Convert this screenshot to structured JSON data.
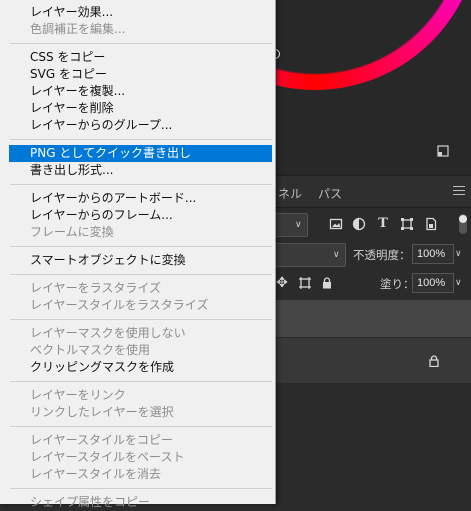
{
  "menu": {
    "items": [
      {
        "label": "レイヤー効果...",
        "enabled": true
      },
      {
        "label": "色調補正を編集...",
        "enabled": false
      },
      {
        "label": "CSS をコピー",
        "enabled": true
      },
      {
        "label": "SVG をコピー",
        "enabled": true
      },
      {
        "label": "レイヤーを複製...",
        "enabled": true
      },
      {
        "label": "レイヤーを削除",
        "enabled": true
      },
      {
        "label": "レイヤーからのグループ...",
        "enabled": true
      },
      {
        "label": "PNG としてクイック書き出し",
        "enabled": true,
        "highlighted": true
      },
      {
        "label": "書き出し形式...",
        "enabled": true
      },
      {
        "label": "レイヤーからのアートボード...",
        "enabled": true
      },
      {
        "label": "レイヤーからのフレーム...",
        "enabled": true
      },
      {
        "label": "フレームに変換",
        "enabled": false
      },
      {
        "label": "スマートオブジェクトに変換",
        "enabled": true
      },
      {
        "label": "レイヤーをラスタライズ",
        "enabled": false
      },
      {
        "label": "レイヤースタイルをラスタライズ",
        "enabled": false
      },
      {
        "label": "レイヤーマスクを使用しない",
        "enabled": false
      },
      {
        "label": "ベクトルマスクを使用",
        "enabled": false
      },
      {
        "label": "クリッピングマスクを作成",
        "enabled": true
      },
      {
        "label": "レイヤーをリンク",
        "enabled": false
      },
      {
        "label": "リンクしたレイヤーを選択",
        "enabled": false
      },
      {
        "label": "レイヤースタイルをコピー",
        "enabled": false
      },
      {
        "label": "レイヤースタイルをペースト",
        "enabled": false
      },
      {
        "label": "レイヤースタイルを消去",
        "enabled": false
      },
      {
        "label": "シェイプ属性をコピー",
        "enabled": false
      }
    ],
    "highlight_color": "#0078d7"
  },
  "layers_panel": {
    "tabs": [
      "ネル",
      "パス"
    ],
    "opacity_label": "不透明度：",
    "opacity_value": "100%",
    "fill_label": "塗り：",
    "fill_value": "100%"
  },
  "icons": {
    "edge_glyph": "G",
    "filter_pixel": "pixel-filter-icon",
    "filter_adjust": "adjustment-filter-icon",
    "filter_type": "T",
    "filter_shape": "shape-filter-icon",
    "filter_smart": "smart-object-filter-icon",
    "lock_position": "✥"
  }
}
